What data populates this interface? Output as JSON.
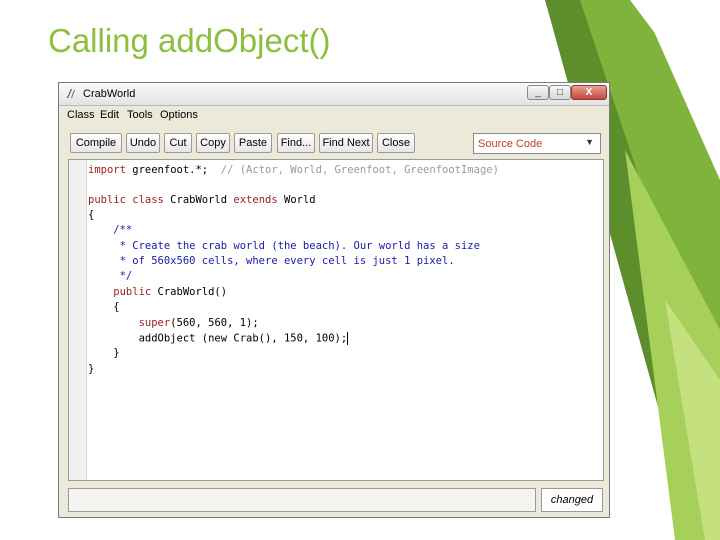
{
  "slide": {
    "title": "Calling addObject()"
  },
  "window": {
    "title": "CrabWorld",
    "controls": {
      "minimize": "_",
      "maximize": "□",
      "close": "X"
    }
  },
  "menu": [
    "Class",
    "Edit",
    "Tools",
    "Options"
  ],
  "toolbar": [
    "Compile",
    "Undo",
    "Cut",
    "Copy",
    "Paste",
    "Find...",
    "Find Next",
    "Close"
  ],
  "view_select": {
    "value": "Source Code",
    "icon": "chevron-down-icon"
  },
  "code": {
    "line_import_kw": "import",
    "line_import_rest": " greenfoot.*;",
    "line_import_comment": "  // (Actor, World, Greenfoot, GreenfootImage)",
    "line_class_kw1": "public class",
    "line_class_name": " CrabWorld ",
    "line_class_kw2": "extends",
    "line_class_super": " World",
    "open_brace": "{",
    "doc_1": "    /**",
    "doc_2": "     * Create the crab world (the beach). Our world has a size",
    "doc_3": "     * of 560x560 cells, where every cell is just 1 pixel.",
    "doc_4": "     */",
    "ctor_kw": "    public",
    "ctor_rest": " CrabWorld()",
    "ctor_open": "    {",
    "super_kw": "        super",
    "super_rest": "(560, 560, 1);",
    "add_call": "        addObject (new Crab(), 150, 100);",
    "ctor_close": "    }",
    "close_brace": "}"
  },
  "status": {
    "message": "",
    "state": "changed"
  },
  "colors": {
    "accent_green": "#8cbf3f",
    "keyword": "#9b1c1c",
    "doc_comment": "#1a1aa8"
  }
}
